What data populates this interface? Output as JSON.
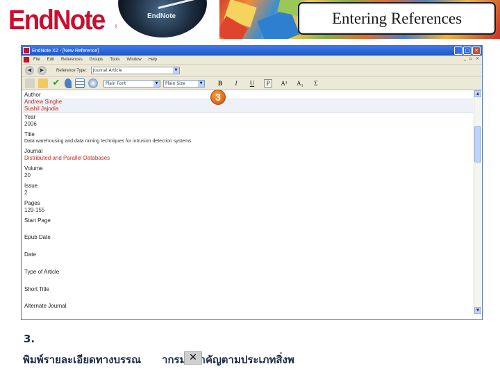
{
  "banner": {
    "logo_text": "EndNote",
    "logo_reg": "®",
    "dial_label": "EndNote",
    "slide_title": "Entering References"
  },
  "window": {
    "title": "EndNote X2 - [New Reference]",
    "menu": [
      "File",
      "Edit",
      "References",
      "Groups",
      "Tools",
      "Window",
      "Help"
    ],
    "reference_type_label": "Reference Type:",
    "reference_type_value": "Journal Article",
    "font_value": "Plain Font",
    "size_value": "Plain Size",
    "format_buttons": [
      "B",
      "I",
      "U",
      "P",
      "A¹",
      "A₁",
      "Σ"
    ]
  },
  "fields": [
    {
      "label": "Author",
      "values": [
        "Andrew Singhe",
        "Sushil Jajodia"
      ],
      "red": true
    },
    {
      "label": "Year",
      "values": [
        "2006"
      ],
      "red": false
    },
    {
      "label": "Title",
      "values": [
        "Data warehousing and data mining techniques for intrusion detection systems"
      ],
      "red": false
    },
    {
      "label": "Journal",
      "values": [
        "Distributed and Parallel Databases"
      ],
      "red": true
    },
    {
      "label": "Volume",
      "values": [
        "20"
      ],
      "red": false
    },
    {
      "label": "Issue",
      "values": [
        "2"
      ],
      "red": false
    },
    {
      "label": "Pages",
      "values": [
        "129-155"
      ],
      "red": false
    },
    {
      "label": "Start Page",
      "values": [],
      "red": false
    },
    {
      "label": "Epub Date",
      "values": [],
      "red": false
    },
    {
      "label": "Date",
      "values": [],
      "red": false
    },
    {
      "label": "Type of Article",
      "values": [],
      "red": false
    },
    {
      "label": "Short Title",
      "values": [],
      "red": false
    },
    {
      "label": "Alternate Journal",
      "values": [],
      "red": false
    }
  ],
  "marker": "3",
  "caption": {
    "step": "3.",
    "text_before": "พิมพ์รายละเอียดทางบรรณ",
    "text_after": "ากรมที่สำคัญตามประเภทสิ่งพ"
  },
  "colors": {
    "logo_red": "#c8102e",
    "titlebar_blue": "#1e55c8",
    "field_red": "#c42a20",
    "marker_orange": "#d8661a",
    "caption_navy": "#1f2d4a"
  }
}
